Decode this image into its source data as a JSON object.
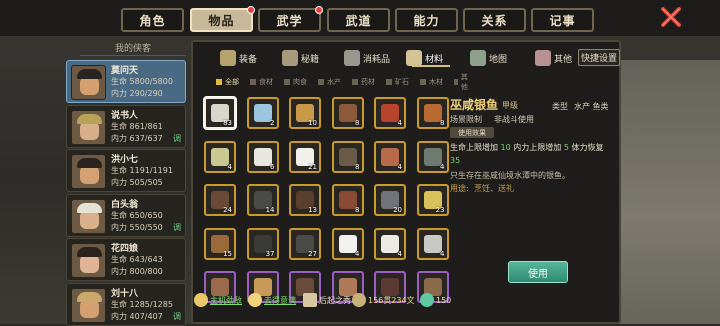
{
  "top_tabs": [
    {
      "label": "角色",
      "active": false,
      "dot": false
    },
    {
      "label": "物品",
      "active": true,
      "dot": true
    },
    {
      "label": "武学",
      "active": false,
      "dot": true
    },
    {
      "label": "武道",
      "active": false,
      "dot": false
    },
    {
      "label": "能力",
      "active": false,
      "dot": false
    },
    {
      "label": "关系",
      "active": false,
      "dot": false
    },
    {
      "label": "记事",
      "active": false,
      "dot": false
    }
  ],
  "party": {
    "header": "我的侠客",
    "members": [
      {
        "name": "莫问天",
        "hp": "生命 5800/5800",
        "mp": "内力 290/290",
        "tag": "",
        "active": true,
        "skin": "#d4a070",
        "hair": "#2a2420"
      },
      {
        "name": "说书人",
        "hp": "生命 861/861",
        "mp": "内力 637/637",
        "tag": "调",
        "active": false,
        "skin": "#d8b088",
        "hair": "#b7a25a"
      },
      {
        "name": "洪小七",
        "hp": "生命 1191/1191",
        "mp": "内力 505/505",
        "tag": "",
        "active": false,
        "skin": "#d3a173",
        "hair": "#2a2420"
      },
      {
        "name": "白头翁",
        "hp": "生命 650/650",
        "mp": "内力 550/550",
        "tag": "调",
        "active": false,
        "skin": "#dab08a",
        "hair": "#e5e2d8"
      },
      {
        "name": "花四娘",
        "hp": "生命 643/643",
        "mp": "内力 800/800",
        "tag": "",
        "active": false,
        "skin": "#e2b496",
        "hair": "#2c221e"
      },
      {
        "name": "刘十八",
        "hp": "生命 1285/1285",
        "mp": "内力 407/407",
        "tag": "调",
        "active": false,
        "skin": "#d4a070",
        "hair": "#c9a96b"
      }
    ]
  },
  "categories": [
    {
      "label": "装备",
      "icon": "armor-icon"
    },
    {
      "label": "秘籍",
      "icon": "book-icon"
    },
    {
      "label": "消耗品",
      "icon": "flask-icon"
    },
    {
      "label": "材料",
      "icon": "material-icon",
      "active": true
    },
    {
      "label": "地图",
      "icon": "map-icon"
    },
    {
      "label": "其他",
      "icon": "other-icon"
    }
  ],
  "quick_settings": "快捷设置",
  "filters": [
    {
      "label": "全部",
      "active": true
    },
    {
      "label": "食材"
    },
    {
      "label": "肉食"
    },
    {
      "label": "水产"
    },
    {
      "label": "药材"
    },
    {
      "label": "矿石"
    },
    {
      "label": "木材"
    },
    {
      "label": "其他"
    }
  ],
  "grid": [
    [
      {
        "count": "83",
        "color": "#d9d6cc",
        "sel": true
      },
      {
        "count": "2",
        "color": "#9cc6e0"
      },
      {
        "count": "10",
        "color": "#c89a48"
      },
      {
        "count": "8",
        "color": "#8a5a3a"
      },
      {
        "count": "4",
        "color": "#b8442e"
      },
      {
        "count": "8",
        "color": "#b86a32"
      }
    ],
    [
      {
        "count": "4",
        "color": "#c9c890"
      },
      {
        "count": "6",
        "color": "#e8e6e0"
      },
      {
        "count": "21",
        "color": "#f2f0ea"
      },
      {
        "count": "8",
        "color": "#6a5a48"
      },
      {
        "count": "4",
        "color": "#b86a4a"
      },
      {
        "count": "4",
        "color": "#6f7a72"
      }
    ],
    [
      {
        "count": "24",
        "color": "#6a4a36"
      },
      {
        "count": "14",
        "color": "#4a4a48"
      },
      {
        "count": "13",
        "color": "#5a3e30"
      },
      {
        "count": "8",
        "color": "#8a4a36"
      },
      {
        "count": "20",
        "color": "#707478"
      },
      {
        "count": "23",
        "color": "#d9c25a"
      }
    ],
    [
      {
        "count": "15",
        "color": "#9a6a3a"
      },
      {
        "count": "37",
        "color": "#3a3a38"
      },
      {
        "count": "27",
        "color": "#4a4a48"
      },
      {
        "count": "4",
        "color": "#f2f2ee"
      },
      {
        "count": "4",
        "color": "#ecebe6"
      },
      {
        "count": "4",
        "color": "#c8c8c4"
      }
    ],
    [
      {
        "count": "",
        "color": "#9a6a4a",
        "purple": true
      },
      {
        "count": "",
        "color": "#c89a5a",
        "purple": true
      },
      {
        "count": "",
        "color": "#6a4a3a",
        "purple": true
      },
      {
        "count": "",
        "color": "#b07a5a",
        "purple": true
      },
      {
        "count": "",
        "color": "#5a3a32",
        "purple": true
      },
      {
        "count": "",
        "color": "#8a6a4a",
        "purple": true
      }
    ]
  ],
  "detail": {
    "name": "巫咸银鱼",
    "grade": "甲级",
    "type_label": "类型",
    "type_value": "水产 鱼类",
    "restrict_label": "场景限制",
    "restrict_value": "非战斗使用",
    "effect_badge": "使用效果",
    "effect_pre": "生命上限增加",
    "effect_v1": "10",
    "effect_mid1": "内力上限增加",
    "effect_v2": "5",
    "effect_mid2": "体力恢复",
    "effect_v3": "35",
    "desc": "只生存在巫咸仙境水潭中的银鱼。",
    "use_label": "用途:",
    "use_value": "烹饪、送礼"
  },
  "use_button": "使用",
  "bottom": {
    "item1": "主机劲敌",
    "item2": "去得意满",
    "item3": "后起之秀",
    "money": "156贯234文",
    "gems": "150"
  },
  "colors": {
    "accent": "#c99a2c",
    "active_member": "#4a6a84",
    "use_button": "#3f9f83"
  }
}
